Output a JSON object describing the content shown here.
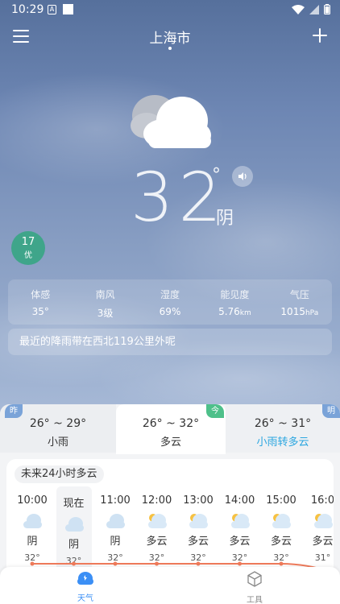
{
  "status_bar": {
    "time": "10:29",
    "a_icon_letter": "A"
  },
  "header": {
    "city": "上海市",
    "menu_icon": "menu-icon",
    "add_icon": "plus-icon"
  },
  "current": {
    "temperature": "32",
    "degree_symbol": "°",
    "condition": "阴"
  },
  "air_quality": {
    "value": "17",
    "quality": "优",
    "color": "#3fa58a"
  },
  "stats": [
    {
      "label": "体感",
      "value": "35°",
      "unit": ""
    },
    {
      "label": "南风",
      "value": "3级",
      "unit": ""
    },
    {
      "label": "湿度",
      "value": "69%",
      "unit": ""
    },
    {
      "label": "能见度",
      "value": "5.76",
      "unit": "km"
    },
    {
      "label": "气压",
      "value": "1015",
      "unit": "hPa"
    }
  ],
  "rain_note": "最近的降雨带在西北119公里外呢",
  "days": {
    "yesterday": {
      "badge": "昨",
      "range": "26° ~ 29°",
      "condition": "小雨"
    },
    "today": {
      "badge": "今",
      "range": "26° ~ 32°",
      "condition": "多云"
    },
    "tomorrow": {
      "badge": "明",
      "range": "26° ~ 31°",
      "condition": "小雨转多云"
    }
  },
  "hourly": {
    "title": "未来24小时多云",
    "items": [
      {
        "time": "10:00",
        "condition": "阴",
        "temp": "32°",
        "icon": "cloudy-icon"
      },
      {
        "time": "现在",
        "condition": "阴",
        "temp": "32°",
        "icon": "cloudy-icon"
      },
      {
        "time": "11:00",
        "condition": "阴",
        "temp": "32°",
        "icon": "cloudy-icon"
      },
      {
        "time": "12:00",
        "condition": "多云",
        "temp": "32°",
        "icon": "partly-cloudy-icon"
      },
      {
        "time": "13:00",
        "condition": "多云",
        "temp": "32°",
        "icon": "partly-cloudy-icon"
      },
      {
        "time": "14:00",
        "condition": "多云",
        "temp": "32°",
        "icon": "partly-cloudy-icon"
      },
      {
        "time": "15:00",
        "condition": "多云",
        "temp": "32°",
        "icon": "partly-cloudy-icon"
      },
      {
        "time": "16:0",
        "condition": "多云",
        "temp": "31°",
        "icon": "partly-cloudy-icon"
      }
    ]
  },
  "bottom_nav": {
    "weather": {
      "label": "天气",
      "icon": "weather-icon",
      "color": "#3b8ff5"
    },
    "tools": {
      "label": "工具",
      "icon": "cube-icon"
    }
  }
}
